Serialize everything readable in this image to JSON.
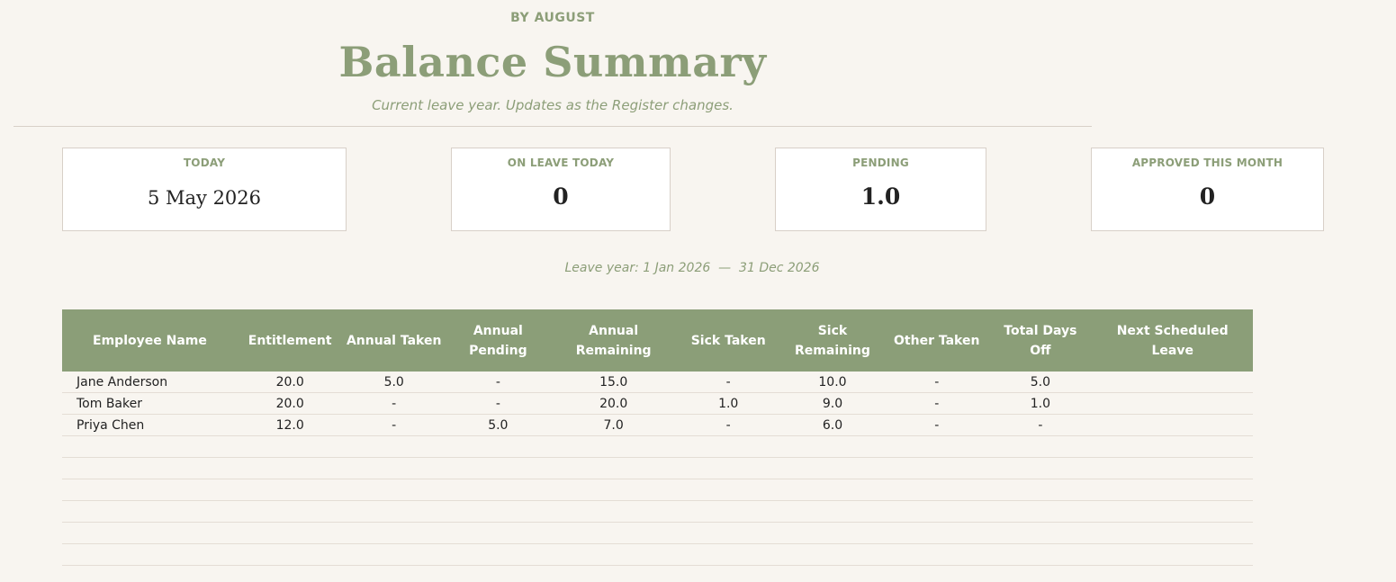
{
  "header": {
    "brand": "BY AUGUST",
    "title": "Balance Summary",
    "subtitle": "Current leave year. Updates as the Register changes."
  },
  "cards": {
    "today": {
      "label": "TODAY",
      "value": "5 May 2026"
    },
    "on_leave_today": {
      "label": "ON LEAVE TODAY",
      "value": "0"
    },
    "pending": {
      "label": "PENDING",
      "value": "1.0"
    },
    "approved_this_month": {
      "label": "APPROVED THIS MONTH",
      "value": "0"
    }
  },
  "leave_year": "Leave year: 1 Jan 2026  —  31 Dec 2026",
  "table": {
    "columns": [
      "Employee Name",
      "Entitlement",
      "Annual Taken",
      "Annual Pending",
      "Annual Remaining",
      "Sick Taken",
      "Sick Remaining",
      "Other Taken",
      "Total Days Off",
      "Next Scheduled Leave"
    ],
    "rows": [
      [
        "Jane Anderson",
        "20.0",
        "5.0",
        "-",
        "15.0",
        "-",
        "10.0",
        "-",
        "5.0",
        ""
      ],
      [
        "Tom Baker",
        "20.0",
        "-",
        "-",
        "20.0",
        "1.0",
        "9.0",
        "-",
        "1.0",
        ""
      ],
      [
        "Priya Chen",
        "12.0",
        "-",
        "5.0",
        "7.0",
        "-",
        "6.0",
        "-",
        "-",
        ""
      ],
      [
        "",
        "",
        "",
        "",
        "",
        "",
        "",
        "",
        "",
        ""
      ],
      [
        "",
        "",
        "",
        "",
        "",
        "",
        "",
        "",
        "",
        ""
      ],
      [
        "",
        "",
        "",
        "",
        "",
        "",
        "",
        "",
        "",
        ""
      ],
      [
        "",
        "",
        "",
        "",
        "",
        "",
        "",
        "",
        "",
        ""
      ],
      [
        "",
        "",
        "",
        "",
        "",
        "",
        "",
        "",
        "",
        ""
      ],
      [
        "",
        "",
        "",
        "",
        "",
        "",
        "",
        "",
        "",
        ""
      ]
    ]
  },
  "colors": {
    "accent": "#8b9e78",
    "background": "#f8f5f0",
    "card_border": "#d8d0c8"
  }
}
